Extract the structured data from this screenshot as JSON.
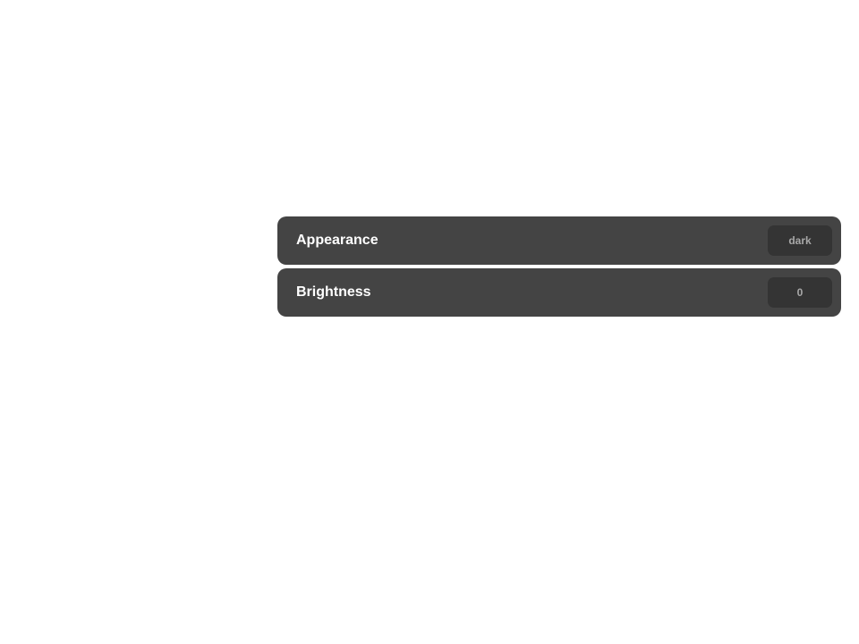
{
  "settings": {
    "rows": [
      {
        "label": "Appearance",
        "value": "dark"
      },
      {
        "label": "Brightness",
        "value": "0"
      }
    ]
  },
  "colors": {
    "row_background": "#444444",
    "value_background": "#343434",
    "label_text": "#ffffff",
    "value_text": "#a8a8a8"
  }
}
